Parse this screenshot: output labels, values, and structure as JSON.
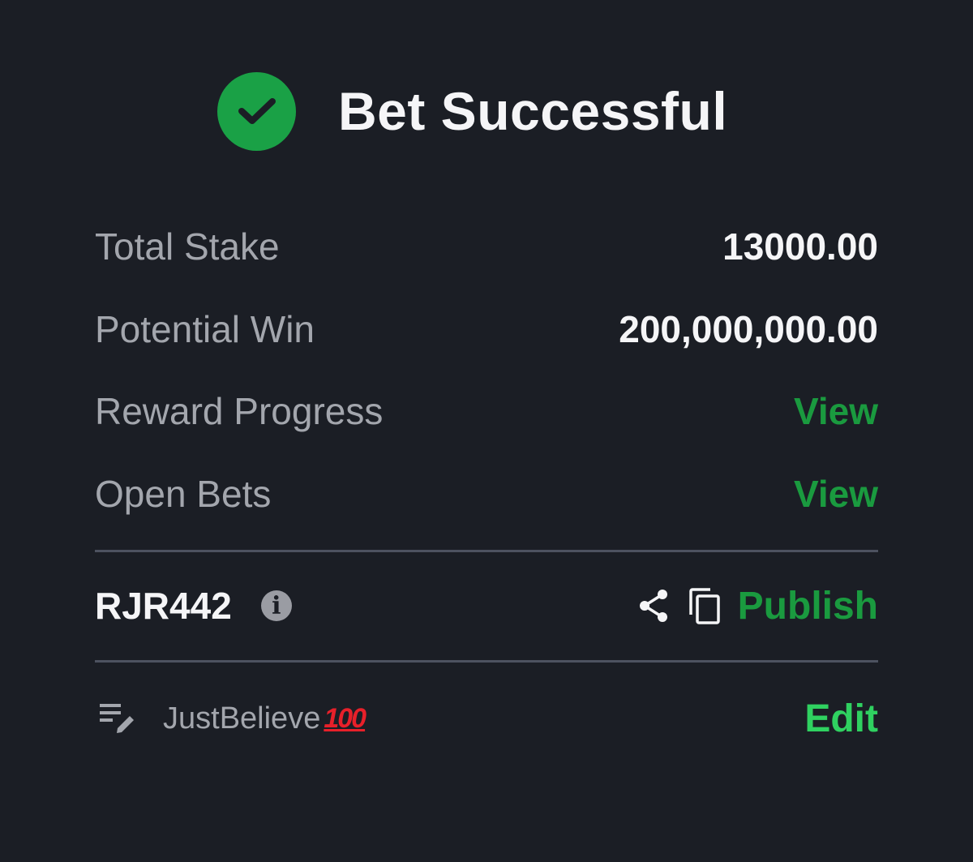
{
  "header": {
    "title": "Bet Successful",
    "status_icon": "check-circle-icon",
    "accent_color": "#1aa146"
  },
  "summary": {
    "total_stake_label": "Total Stake",
    "total_stake_value": "13000.00",
    "potential_win_label": "Potential Win",
    "potential_win_value": "200,000,000.00",
    "reward_progress_label": "Reward Progress",
    "reward_progress_link": "View",
    "open_bets_label": "Open Bets",
    "open_bets_link": "View",
    "link_color": "#1a9a3f"
  },
  "booking": {
    "code": "RJR442",
    "info_icon": "info-icon",
    "share_icon": "share-icon",
    "copy_icon": "copy-icon",
    "publish_label": "Publish"
  },
  "note": {
    "icon": "note-edit-icon",
    "text": "JustBelieve",
    "emoji": "100",
    "edit_label": "Edit",
    "edit_color": "#2fd160"
  }
}
